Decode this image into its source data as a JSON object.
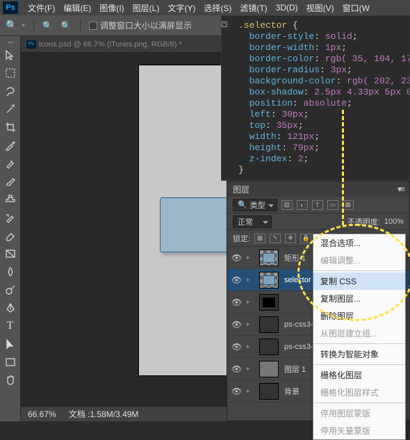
{
  "menu": {
    "items": [
      "文件(F)",
      "编辑(E)",
      "图像(I)",
      "图层(L)",
      "文字(Y)",
      "选择(S)",
      "滤镜(T)",
      "3D(D)",
      "视图(V)",
      "窗口(W"
    ]
  },
  "options": {
    "checkbox_label": "调整窗口大小以满屏显示"
  },
  "document": {
    "tab": "icons.psd @ 66.7% (iTunes.png, RGB/8) *",
    "zoom": "66.67%",
    "docsize": "文档 :1.58M/3.49M"
  },
  "code": {
    "selector": ".selector",
    "props": [
      {
        "k": "border-style",
        "v": "solid"
      },
      {
        "k": "border-width",
        "v": "1px"
      },
      {
        "k": "border-color",
        "v": "rgb( 35, 104, 17"
      },
      {
        "k": "border-radius",
        "v": "3px"
      },
      {
        "k": "background-color",
        "v": "rgb( 202, 23"
      },
      {
        "k": "box-shadow",
        "v": "2.5px 4.33px 5px 0"
      },
      {
        "k": "position",
        "v": "absolute"
      },
      {
        "k": "left",
        "v": "30px"
      },
      {
        "k": "top",
        "v": "35px"
      },
      {
        "k": "width",
        "v": "121px"
      },
      {
        "k": "height",
        "v": "79px"
      },
      {
        "k": "z-index",
        "v": "2"
      }
    ],
    "brace_open": "{",
    "brace_close": "}"
  },
  "layers": {
    "tab": "图层",
    "kind": "类型",
    "blend_mode": "正常",
    "opacity_label": "不透明度:",
    "opacity_value": "100%",
    "lock_label": "锁定:",
    "items": [
      {
        "name": "矩形 1"
      },
      {
        "name": "selector"
      },
      {
        "name": ""
      },
      {
        "name": "ps-css3-..."
      },
      {
        "name": "ps-css3-..."
      },
      {
        "name": "图层 1"
      },
      {
        "name": "背景"
      }
    ]
  },
  "context_menu": {
    "blend_opts": "混合选项...",
    "edit_adj": "编辑调整...",
    "copy_css": "复制 CSS",
    "dup_layer": "复制图层...",
    "del_layer": "删除图层",
    "group_from": "从图层建立组...",
    "smart_obj": "转换为智能对象",
    "rasterize": "栅格化图层",
    "rasterize_style": "栅格化图层样式",
    "disable_mask": "停用图层蒙版",
    "disable_vmask": "停用矢量蒙版"
  }
}
